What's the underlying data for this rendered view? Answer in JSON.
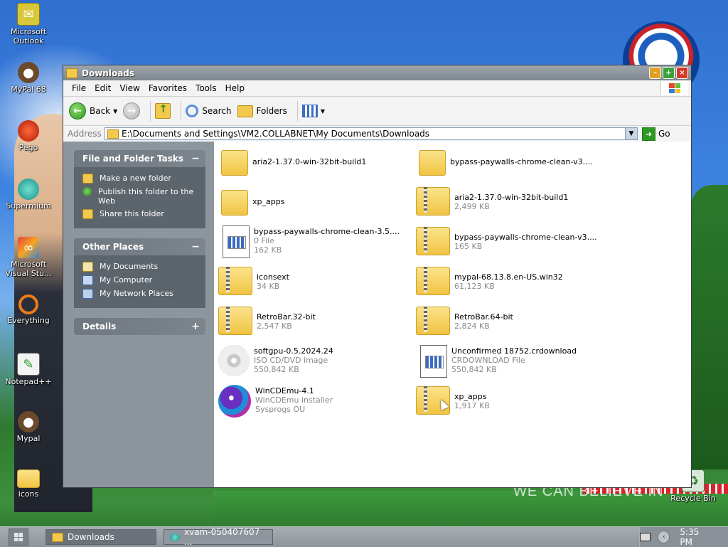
{
  "desktop": {
    "icons": [
      {
        "label": "Microsoft Outlook",
        "icon": "outlook-icon"
      },
      {
        "label": "MyPal 68",
        "icon": "mypal-icon"
      },
      {
        "label": "Pego",
        "icon": "pego-icon"
      },
      {
        "label": "Supermium",
        "icon": "supermium-icon"
      },
      {
        "label": "Microsoft Visual Stu...",
        "icon": "visual-studio-icon"
      },
      {
        "label": "Everything",
        "icon": "everything-icon"
      },
      {
        "label": "Notepad++",
        "icon": "notepadpp-icon"
      },
      {
        "label": "Mypal",
        "icon": "mypal-icon"
      },
      {
        "label": "icons",
        "icon": "folder-icon"
      },
      {
        "label": "Recycle Bin",
        "icon": "recycle-bin-icon"
      }
    ],
    "wallpaper_text": "WE CAN BELIEVE IN"
  },
  "window": {
    "title": "Downloads",
    "menu": [
      "File",
      "Edit",
      "View",
      "Favorites",
      "Tools",
      "Help"
    ],
    "toolbar": {
      "back_label": "Back",
      "search_label": "Search",
      "folders_label": "Folders"
    },
    "address": {
      "label": "Address",
      "value": "E:\\Documents and Settings\\VM2.COLLABNET\\My Documents\\Downloads",
      "go_label": "Go"
    },
    "taskpane": {
      "file_tasks": {
        "title": "File and Folder Tasks",
        "toggle": "−",
        "items": [
          "Make a new folder",
          "Publish this folder to the Web",
          "Share this folder"
        ]
      },
      "other_places": {
        "title": "Other Places",
        "toggle": "−",
        "items": [
          "My Documents",
          "My Computer",
          "My Network Places"
        ]
      },
      "details": {
        "title": "Details",
        "toggle": "+"
      }
    },
    "files": [
      {
        "name": "aria2-1.37.0-win-32bit-build1",
        "line2": "",
        "line3": "",
        "type": "folder"
      },
      {
        "name": "bypass-paywalls-chrome-clean-v3....",
        "line2": "",
        "line3": "",
        "type": "folder"
      },
      {
        "name": "xp_apps",
        "line2": "",
        "line3": "",
        "type": "folder"
      },
      {
        "name": "aria2-1.37.0-win-32bit-build1",
        "line2": "2,499 KB",
        "line3": "",
        "type": "zip"
      },
      {
        "name": "bypass-paywalls-chrome-clean-3.5....",
        "line2": "0 File",
        "line3": "162 KB",
        "type": "doc"
      },
      {
        "name": "bypass-paywalls-chrome-clean-v3....",
        "line2": "165 KB",
        "line3": "",
        "type": "zip"
      },
      {
        "name": "iconsext",
        "line2": "34 KB",
        "line3": "",
        "type": "zip"
      },
      {
        "name": "mypal-68.13.8.en-US.win32",
        "line2": "61,123 KB",
        "line3": "",
        "type": "zip"
      },
      {
        "name": "RetroBar.32-bit",
        "line2": "2,547 KB",
        "line3": "",
        "type": "zip"
      },
      {
        "name": "RetroBar.64-bit",
        "line2": "2,824 KB",
        "line3": "",
        "type": "zip"
      },
      {
        "name": "softgpu-0.5.2024.24",
        "line2": "ISO CD/DVD image",
        "line3": "550,842 KB",
        "type": "cd"
      },
      {
        "name": "Unconfirmed 18752.crdownload",
        "line2": "CRDOWNLOAD File",
        "line3": "550,842 KB",
        "type": "doc"
      },
      {
        "name": "WinCDEmu-4.1",
        "line2": "WinCDEmu installer",
        "line3": "Sysprogs OU",
        "type": "cds"
      },
      {
        "name": "xp_apps",
        "line2": "1,917 KB",
        "line3": "",
        "type": "zip"
      }
    ]
  },
  "taskbar": {
    "buttons": [
      {
        "label": "Downloads",
        "active": true
      },
      {
        "label": "xvam-050407607 ...",
        "active": false
      }
    ],
    "clock": "5:35 PM"
  }
}
